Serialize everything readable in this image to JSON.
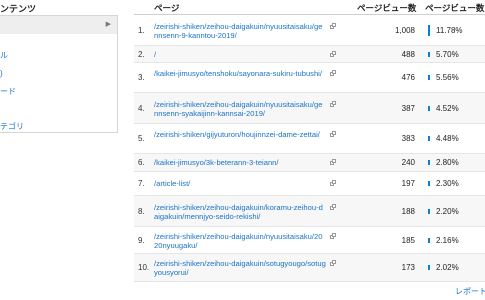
{
  "sidebar": {
    "title": "ンテンツ",
    "items": [
      {
        "label": ""
      },
      {
        "label": "ル"
      },
      {
        "label": ")"
      },
      {
        "label": "ード"
      },
      {
        "label": ""
      },
      {
        "label": ""
      }
    ],
    "category": "テゴリ"
  },
  "table": {
    "headers": {
      "page": "ページ",
      "pageviews": "ページビュー数",
      "pageviews_pct": "ページビュー数"
    },
    "rows": [
      {
        "num": "1.",
        "path": "/zeirishi-shiken/zeihou-daigakuin/nyuusitaisaku/gennsenn-9-kanntou-2019/",
        "views": "1,008",
        "pct": "11.78%",
        "share": 0.1178
      },
      {
        "num": "2.",
        "path": "/",
        "views": "488",
        "pct": "5.70%",
        "share": 0.057
      },
      {
        "num": "3.",
        "path": "/kaikei-jimusyo/tenshoku/sayonara-sukiru-tubushi/",
        "views": "476",
        "pct": "5.56%",
        "share": 0.0556
      },
      {
        "num": "4.",
        "path": "/zeirishi-shiken/zeihou-daigakuin/nyuusitaisaku/gennsenn-syakaijinn-kannsai-2019/",
        "views": "387",
        "pct": "4.52%",
        "share": 0.0452
      },
      {
        "num": "5.",
        "path": "/zeirishi-shiken/gijyuturon/houjinnzei-dame-zettai/",
        "views": "383",
        "pct": "4.48%",
        "share": 0.0448
      },
      {
        "num": "6.",
        "path": "/kaikei-jimusyo/3k-beterann-3-teiann/",
        "views": "240",
        "pct": "2.80%",
        "share": 0.028
      },
      {
        "num": "7.",
        "path": "/article-list/",
        "views": "197",
        "pct": "2.30%",
        "share": 0.023
      },
      {
        "num": "8.",
        "path": "/zeirishi-shiken/zeihou-daigakuin/koramu-zeihou-daigakuin/mennjyo-seido-rekishi/",
        "views": "188",
        "pct": "2.20%",
        "share": 0.022
      },
      {
        "num": "9.",
        "path": "/zeirishi-shiken/zeihou-daigakuin/nyuusitaisaku/2020nyuugaku/",
        "views": "185",
        "pct": "2.16%",
        "share": 0.0216
      },
      {
        "num": "10.",
        "path": "/zeirishi-shiken/zeihou-daigakuin/sotugyougo/sotugyousyorui/",
        "views": "173",
        "pct": "2.02%",
        "share": 0.0202
      }
    ]
  },
  "footer": {
    "report_link": "レポート"
  },
  "colors": {
    "link": "#1a73c8",
    "bar": "#0b7fd4",
    "row_alt": "#f7f7f7"
  },
  "icons": {
    "row_icon": "copy-icon",
    "sidebar_arrow": "chevron-right-icon"
  }
}
